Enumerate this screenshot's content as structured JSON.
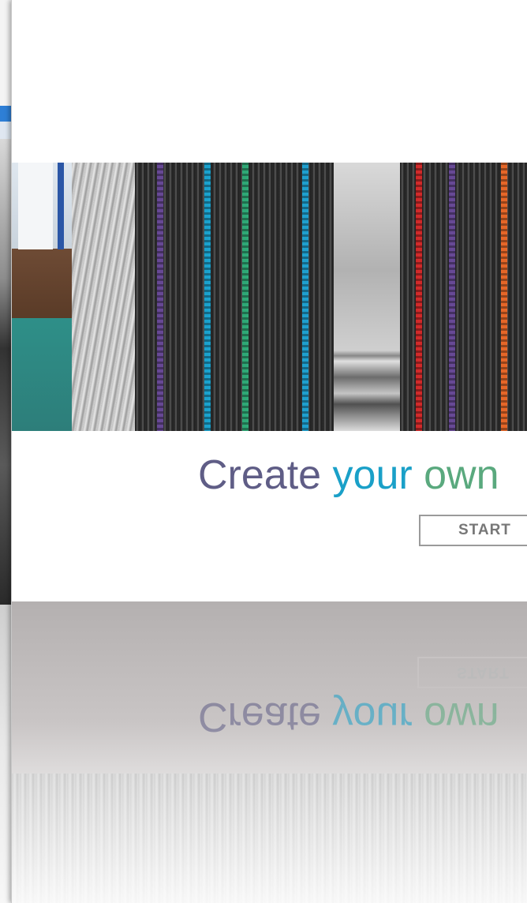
{
  "hero": {
    "tagline_words": [
      "Create",
      "your",
      "own"
    ],
    "start_label": "START"
  },
  "colors": {
    "word_create": "#5f5d86",
    "word_your": "#1aa0c8",
    "word_own": "#5aa97e"
  },
  "banner": {
    "panels": [
      "room-interior-photo",
      "loom-machine-photo",
      "carpet-tile-stripes",
      "steel-layers-photo",
      "carpet-tile-stripes"
    ]
  }
}
